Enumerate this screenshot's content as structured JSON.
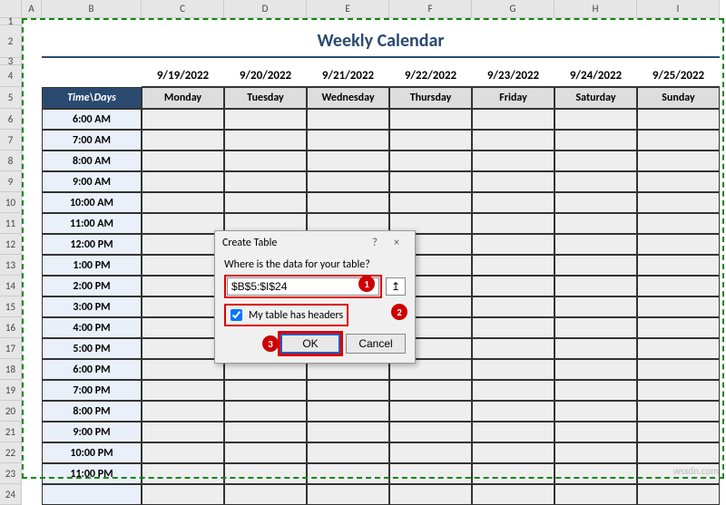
{
  "columns": [
    "A",
    "B",
    "C",
    "D",
    "E",
    "F",
    "G",
    "H",
    "I"
  ],
  "title": "Weekly Calendar",
  "dates": [
    "9/19/2022",
    "9/20/2022",
    "9/21/2022",
    "9/22/2022",
    "9/23/2022",
    "9/24/2022",
    "9/25/2022"
  ],
  "day_header_first": "Time\\Days",
  "days": [
    "Monday",
    "Tuesday",
    "Wednesday",
    "Thursday",
    "Friday",
    "Saturday",
    "Sunday"
  ],
  "times": [
    "6:00 AM",
    "7:00 AM",
    "8:00 AM",
    "9:00 AM",
    "10:00 AM",
    "11:00 AM",
    "12:00 PM",
    "1:00 PM",
    "2:00 PM",
    "3:00 PM",
    "4:00 PM",
    "5:00 PM",
    "6:00 PM",
    "7:00 PM",
    "8:00 PM",
    "9:00 PM",
    "10:00 PM",
    "11:00 PM"
  ],
  "row_numbers": [
    "1",
    "2",
    "3",
    "4",
    "5",
    "6",
    "7",
    "8",
    "9",
    "10",
    "11",
    "12",
    "13",
    "14",
    "15",
    "16",
    "17",
    "18",
    "19",
    "20",
    "21",
    "22",
    "23",
    "24"
  ],
  "dialog": {
    "title": "Create Table",
    "help": "?",
    "close": "×",
    "prompt": "Where is the data for your table?",
    "range": "$B$5:$I$24",
    "range_pick_icon": "↥",
    "checkbox_checked": true,
    "checkbox_label": "My table has headers",
    "ok": "OK",
    "cancel": "Cancel",
    "badge1": "1",
    "badge2": "2",
    "badge3": "3"
  },
  "watermark": "wsxdn.com"
}
